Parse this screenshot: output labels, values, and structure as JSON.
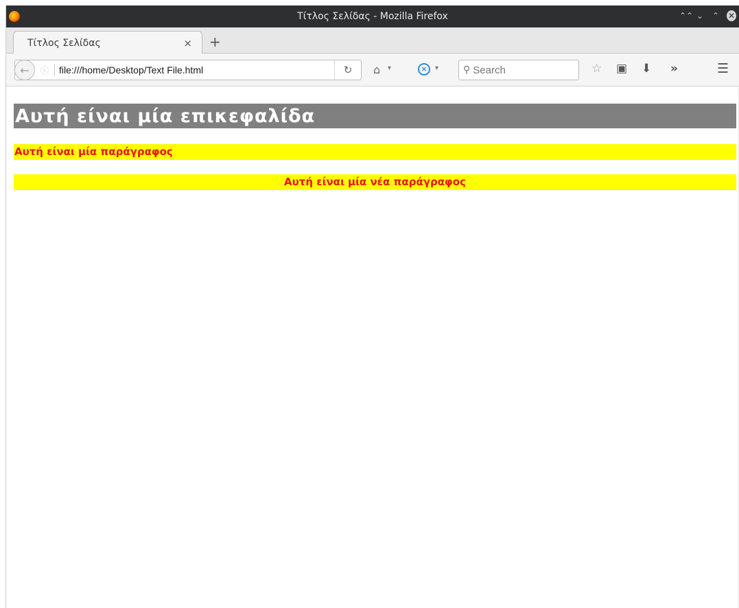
{
  "window": {
    "title": "Τίτλος Σελίδας - Mozilla Firefox",
    "controls": [
      "⌃⌃",
      "⌄",
      "⌃",
      "✕"
    ]
  },
  "tabs": [
    {
      "label": "Τίτλος Σελίδας",
      "close": "×"
    }
  ],
  "new_tab": "+",
  "navbar": {
    "url": "file:///home/Desktop/Text File.html",
    "search_placeholder": "Search"
  },
  "page": {
    "heading": "Αυτή είναι μία επικεφαλίδα",
    "paragraphs": [
      "Αυτή είναι μία παράγραφος",
      "Αυτή είναι μία νέα παράγραφος"
    ]
  },
  "colors": {
    "heading_bg": "#808080",
    "heading_text": "#ffffff",
    "paragraph_bg": "#ffff00",
    "paragraph_text": "#e8140c"
  },
  "icons": [
    "firefox-logo-icon",
    "back-icon",
    "site-info-icon",
    "reload-icon",
    "home-icon",
    "search-engine-icon",
    "search-icon",
    "bookmark-star-icon",
    "reading-list-icon",
    "download-icon",
    "overflow-icon",
    "menu-icon"
  ]
}
